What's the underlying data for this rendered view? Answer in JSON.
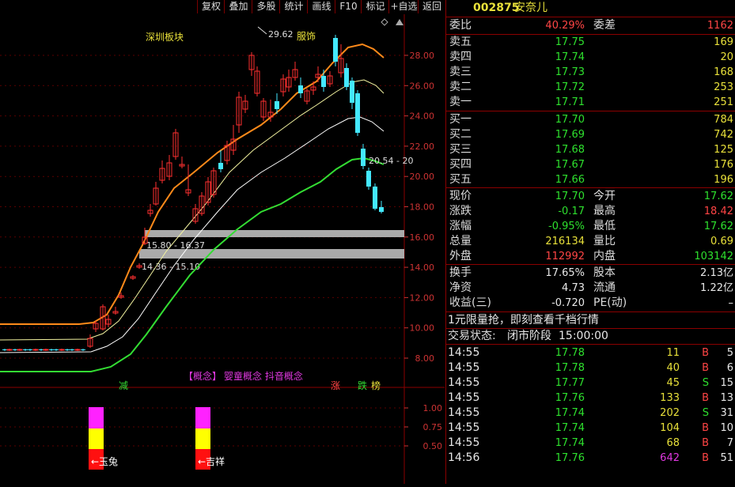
{
  "toolbar": {
    "buttons": [
      "复权",
      "叠加",
      "多股",
      "统计",
      "画线",
      "F10",
      "标记",
      "+自选",
      "返回"
    ]
  },
  "chart": {
    "sector_label": "深圳板块",
    "high_label": "29.62",
    "high_tag": "服饰",
    "ma_label": "20.54 - 20",
    "zone1_label": "15.80 - 16.37",
    "zone2_label": "14.36 - 15.10",
    "concept_prefix": "【概念】",
    "concept_text": "婴童概念 抖音概念",
    "mark_jian": "减",
    "mark_zhang": "涨",
    "mark_die": "跌",
    "mark_bang": "榜",
    "indicator_label1": "←玉兔",
    "indicator_label2": "←吉祥",
    "price_axis": [
      "28.00",
      "26.00",
      "24.00",
      "22.00",
      "20.00",
      "18.00",
      "16.00",
      "14.00",
      "12.00",
      "10.00",
      "8.00"
    ],
    "ind_axis": [
      "1.00",
      "0.75",
      "0.50"
    ],
    "colors": {
      "up": "#ff3030",
      "down": "#44e8ff",
      "ma_orange": "#ff8a1a",
      "ma_yellow": "#f3f3a0",
      "ma_white": "#ffffff",
      "ma_green": "#33dd33",
      "axis": "#cc3333"
    }
  },
  "panel": {
    "code": "002875",
    "name": "安奈儿",
    "weibi_label": "委比",
    "weibi_value": "40.29%",
    "weicha_label": "委差",
    "weicha_value": "1162",
    "sells": [
      {
        "label": "卖五",
        "price": "17.75",
        "vol": "169"
      },
      {
        "label": "卖四",
        "price": "17.74",
        "vol": "20"
      },
      {
        "label": "卖三",
        "price": "17.73",
        "vol": "168"
      },
      {
        "label": "卖二",
        "price": "17.72",
        "vol": "253"
      },
      {
        "label": "卖一",
        "price": "17.71",
        "vol": "251"
      }
    ],
    "buys": [
      {
        "label": "买一",
        "price": "17.70",
        "vol": "784"
      },
      {
        "label": "买二",
        "price": "17.69",
        "vol": "742"
      },
      {
        "label": "买三",
        "price": "17.68",
        "vol": "125"
      },
      {
        "label": "买四",
        "price": "17.67",
        "vol": "176"
      },
      {
        "label": "买五",
        "price": "17.66",
        "vol": "196"
      }
    ],
    "stats": [
      {
        "l1": "现价",
        "v1": "17.70",
        "c1": "green",
        "l2": "今开",
        "v2": "17.62",
        "c2": "green"
      },
      {
        "l1": "涨跌",
        "v1": "-0.17",
        "c1": "green",
        "l2": "最高",
        "v2": "18.42",
        "c2": "red"
      },
      {
        "l1": "涨幅",
        "v1": "-0.95%",
        "c1": "green",
        "l2": "最低",
        "v2": "17.62",
        "c2": "green"
      },
      {
        "l1": "总量",
        "v1": "216134",
        "c1": "yellow",
        "l2": "量比",
        "v2": "0.69",
        "c2": "yellow"
      },
      {
        "l1": "外盘",
        "v1": "112992",
        "c1": "red",
        "l2": "内盘",
        "v2": "103142",
        "c2": "green"
      }
    ],
    "stats2": [
      {
        "l1": "换手",
        "v1": "17.65%",
        "l2": "股本",
        "v2": "2.13亿"
      },
      {
        "l1": "净资",
        "v1": "4.73",
        "l2": "流通",
        "v2": "1.22亿"
      },
      {
        "l1": "收益(三)",
        "v1": "-0.720",
        "l2": "PE(动)",
        "v2": "–"
      }
    ],
    "promo": "1元限量抢，即刻查看千档行情",
    "status_label": "交易状态:",
    "status_value": "闭市阶段",
    "status_time": "15:00:00",
    "ticks": [
      {
        "time": "14:55",
        "price": "17.78",
        "vol": "11",
        "bs": "B",
        "n": "5"
      },
      {
        "time": "14:55",
        "price": "17.78",
        "vol": "40",
        "bs": "B",
        "n": "6"
      },
      {
        "time": "14:55",
        "price": "17.77",
        "vol": "45",
        "bs": "S",
        "n": "15"
      },
      {
        "time": "14:55",
        "price": "17.76",
        "vol": "133",
        "bs": "B",
        "n": "13"
      },
      {
        "time": "14:55",
        "price": "17.74",
        "vol": "202",
        "bs": "S",
        "n": "31"
      },
      {
        "time": "14:55",
        "price": "17.74",
        "vol": "104",
        "bs": "B",
        "n": "10"
      },
      {
        "time": "14:55",
        "price": "17.74",
        "vol": "68",
        "bs": "B",
        "n": "7"
      },
      {
        "time": "14:56",
        "price": "17.76",
        "vol": "642",
        "bs": "B",
        "n": "51"
      }
    ]
  }
}
